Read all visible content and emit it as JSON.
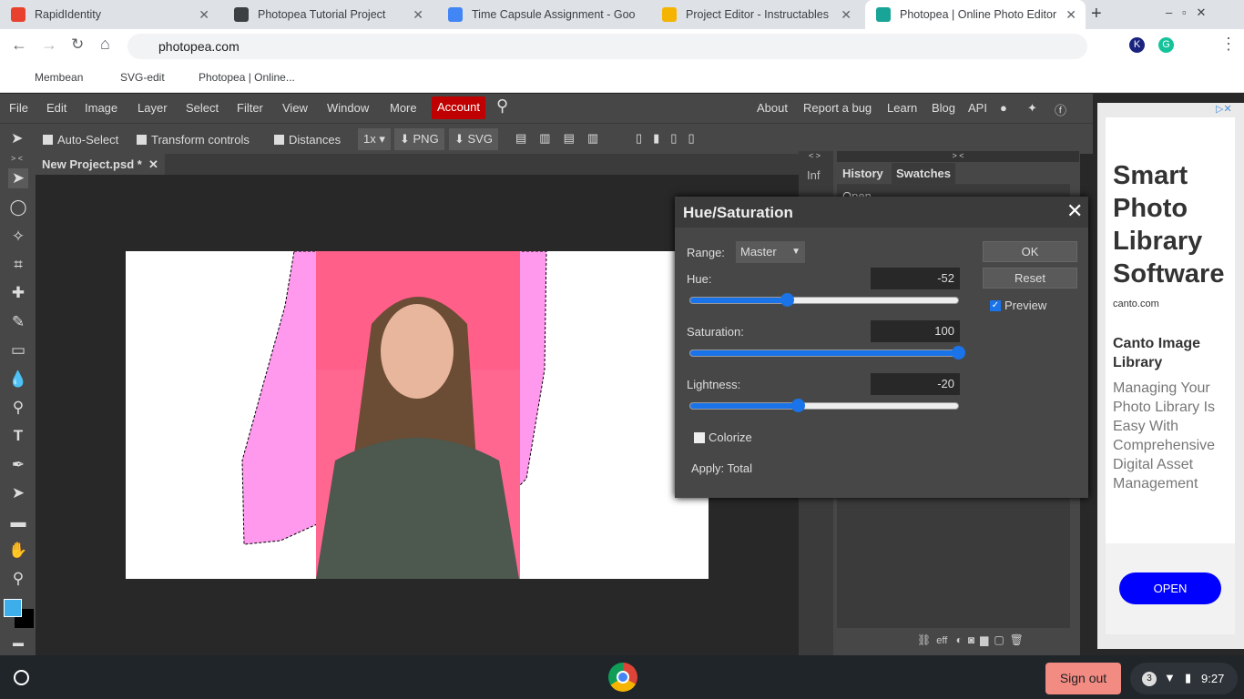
{
  "browser": {
    "tabs": [
      {
        "title": "RapidIdentity",
        "color": "#e8412d"
      },
      {
        "title": "Photopea Tutorial Project",
        "color": "#3c4043"
      },
      {
        "title": "Time Capsule Assignment - Goo",
        "color": "#4285f4"
      },
      {
        "title": "Project Editor - Instructables",
        "color": "#f4b400"
      },
      {
        "title": "Photopea | Online Photo Editor",
        "color": "#18a497"
      }
    ],
    "url": "photopea.com",
    "bookmarks": [
      "Membean",
      "SVG-edit",
      "Photopea | Online..."
    ]
  },
  "menu": {
    "items": [
      "File",
      "Edit",
      "Image",
      "Layer",
      "Select",
      "Filter",
      "View",
      "Window",
      "More"
    ],
    "account": "Account",
    "right": [
      "About",
      "Report a bug",
      "Learn",
      "Blog",
      "API"
    ]
  },
  "options": {
    "auto_select": "Auto-Select",
    "transform": "Transform controls",
    "distances": "Distances",
    "scale": "1x",
    "png": "PNG",
    "svg": "SVG"
  },
  "document": {
    "tab": "New Project.psd *"
  },
  "panels": {
    "collapse_left": "< >",
    "collapse_right": "> <",
    "inf": "Inf",
    "tabs": [
      "History",
      "Swatches"
    ],
    "history": [
      "Open"
    ],
    "footer": "eff"
  },
  "dialog": {
    "title": "Hue/Saturation",
    "range_label": "Range:",
    "range_value": "Master",
    "hue_label": "Hue:",
    "hue": "-52",
    "sat_label": "Saturation:",
    "sat": "100",
    "light_label": "Lightness:",
    "light": "-20",
    "colorize": "Colorize",
    "apply": "Apply: Total",
    "ok": "OK",
    "reset": "Reset",
    "preview": "Preview",
    "hue_pct": 36,
    "sat_pct": 100,
    "light_pct": 40
  },
  "ad": {
    "headline": "Smart Photo Library Software",
    "domain": "canto.com",
    "subhead": "Canto Image Library",
    "body": "Managing Your Photo Library Is Easy With Comprehensive Digital Asset Management",
    "cta": "OPEN"
  },
  "taskbar": {
    "signout": "Sign out",
    "notifications": "3",
    "time": "9:27"
  },
  "colors": {
    "accent": "#1a73e8",
    "account": "#c00000",
    "fg": "#3daee9",
    "bg": "#000000"
  }
}
